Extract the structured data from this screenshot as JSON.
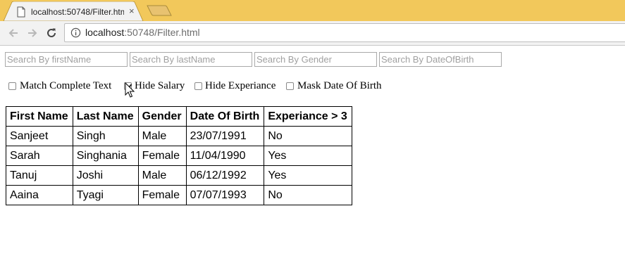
{
  "browser": {
    "tab_title": "localhost:50748/Filter.htm",
    "tab_close_glyph": "×",
    "url_host": "localhost",
    "url_rest": ":50748/Filter.html"
  },
  "icons": {
    "tab_page": "document-icon",
    "close": "close-icon",
    "back": "back-arrow-icon",
    "forward": "forward-arrow-icon",
    "reload": "reload-icon",
    "info": "info-icon",
    "cursor": "mouse-cursor-icon"
  },
  "colors": {
    "tabstrip": "#f2c85b",
    "tab_active": "#f2f2f2",
    "toolbar": "#f2f2f2"
  },
  "search": {
    "first_name_placeholder": "Search By firstName",
    "last_name_placeholder": "Search By lastName",
    "gender_placeholder": "Search By Gender",
    "dob_placeholder": "Search By DateOfBirth"
  },
  "options": [
    {
      "label": "Match Complete Text",
      "checked": false
    },
    {
      "label": "Hide Salary",
      "checked": true
    },
    {
      "label": "Hide Experiance",
      "checked": false
    },
    {
      "label": "Mask Date Of Birth",
      "checked": false
    }
  ],
  "table": {
    "headers": [
      "First Name",
      "Last Name",
      "Gender",
      "Date Of Birth",
      "Experiance > 3"
    ],
    "rows": [
      [
        "Sanjeet",
        "Singh",
        "Male",
        "23/07/1991",
        "No"
      ],
      [
        "Sarah",
        "Singhania",
        "Female",
        "11/04/1990",
        "Yes"
      ],
      [
        "Tanuj",
        "Joshi",
        "Male",
        "06/12/1992",
        "Yes"
      ],
      [
        "Aaina",
        "Tyagi",
        "Female",
        "07/07/1993",
        "No"
      ]
    ]
  }
}
